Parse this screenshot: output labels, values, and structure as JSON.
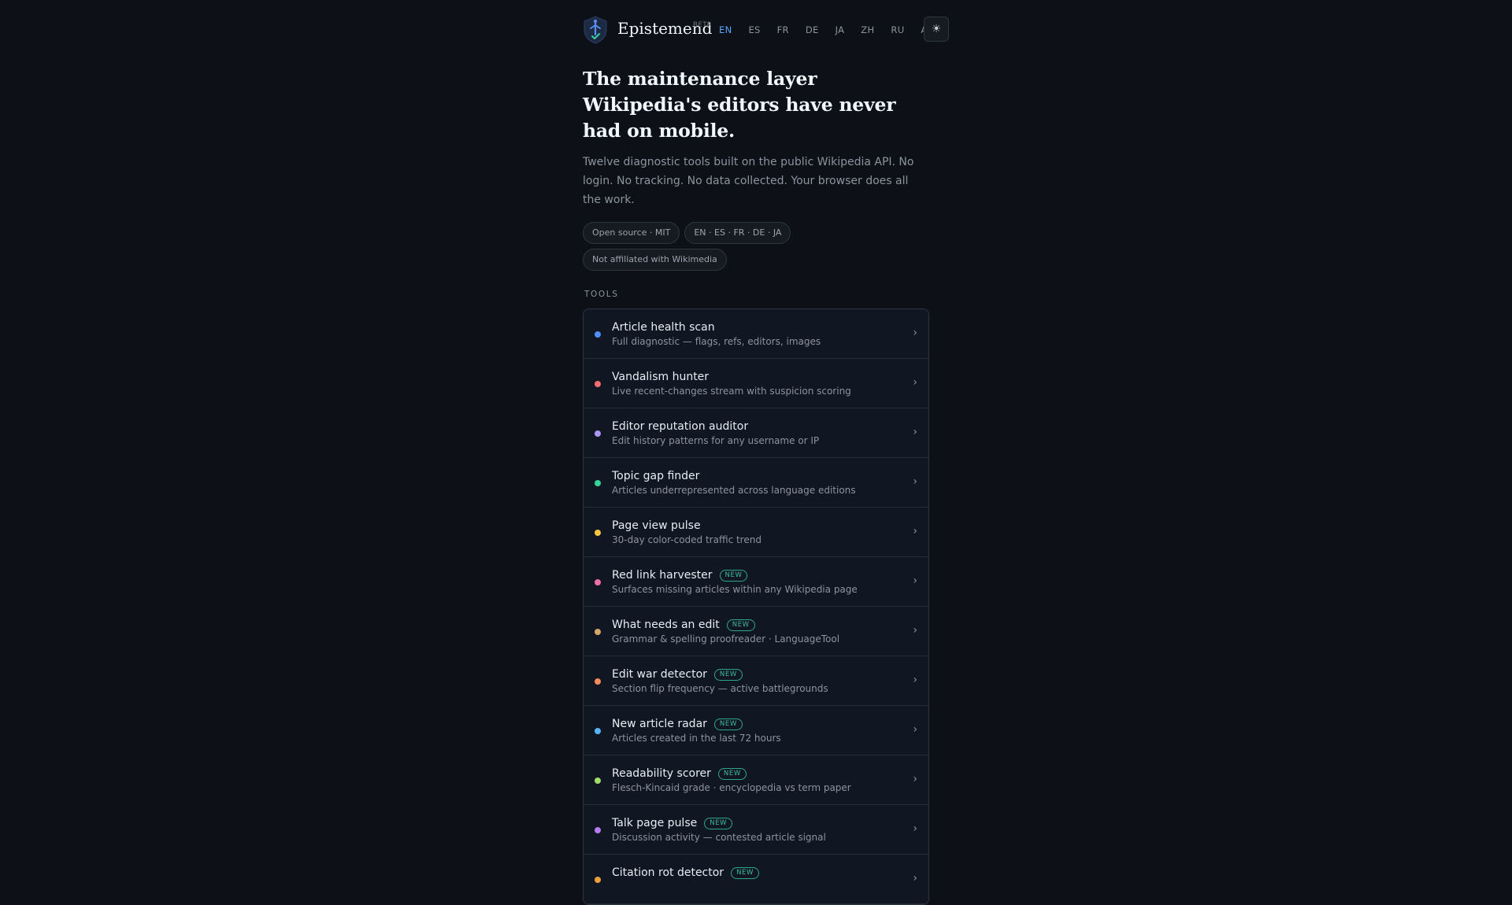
{
  "header": {
    "brand": "Epistemend",
    "beta": "BETA",
    "languages": [
      "EN",
      "ES",
      "FR",
      "DE",
      "JA",
      "ZH",
      "RU",
      "AR"
    ],
    "active_language": "EN",
    "theme_toggle_icon": "☀"
  },
  "hero": {
    "title": "The maintenance layer Wikipedia's editors have never had on mobile.",
    "lede": "Twelve diagnostic tools built on the public Wikipedia API. No login. No tracking. No data collected. Your browser does all the work.",
    "pills": [
      "Open source · MIT",
      "EN · ES · FR · DE · JA",
      "Not affiliated with Wikimedia"
    ]
  },
  "tools_section": {
    "label": "TOOLS",
    "new_badge": "NEW",
    "chevron": "›",
    "items": [
      {
        "name": "Article health scan",
        "desc": "Full diagnostic — flags, refs, editors, images",
        "color": "#4f8ff7",
        "new": false
      },
      {
        "name": "Vandalism hunter",
        "desc": "Live recent-changes stream with suspicion scoring",
        "color": "#f26d6d",
        "new": false
      },
      {
        "name": "Editor reputation auditor",
        "desc": "Edit history patterns for any username or IP",
        "color": "#a995f2",
        "new": false
      },
      {
        "name": "Topic gap finder",
        "desc": "Articles underrepresented across language editions",
        "color": "#35d39a",
        "new": false
      },
      {
        "name": "Page view pulse",
        "desc": "30-day color-coded traffic trend",
        "color": "#f5c542",
        "new": false
      },
      {
        "name": "Red link harvester",
        "desc": "Surfaces missing articles within any Wikipedia page",
        "color": "#ef6fa8",
        "new": true
      },
      {
        "name": "What needs an edit",
        "desc": "Grammar & spelling proofreader · LanguageTool",
        "color": "#d4a86a",
        "new": true
      },
      {
        "name": "Edit war detector",
        "desc": "Section flip frequency — active battlegrounds",
        "color": "#f58a5c",
        "new": true
      },
      {
        "name": "New article radar",
        "desc": "Articles created in the last 72 hours",
        "color": "#56b3f5",
        "new": true
      },
      {
        "name": "Readability scorer",
        "desc": "Flesch-Kincaid grade · encyclopedia vs term paper",
        "color": "#9fdc6a",
        "new": true
      },
      {
        "name": "Talk page pulse",
        "desc": "Discussion activity — contested article signal",
        "color": "#b57bf0",
        "new": true
      },
      {
        "name": "Citation rot detector",
        "desc": "",
        "color": "#e9a23b",
        "new": true
      }
    ]
  }
}
